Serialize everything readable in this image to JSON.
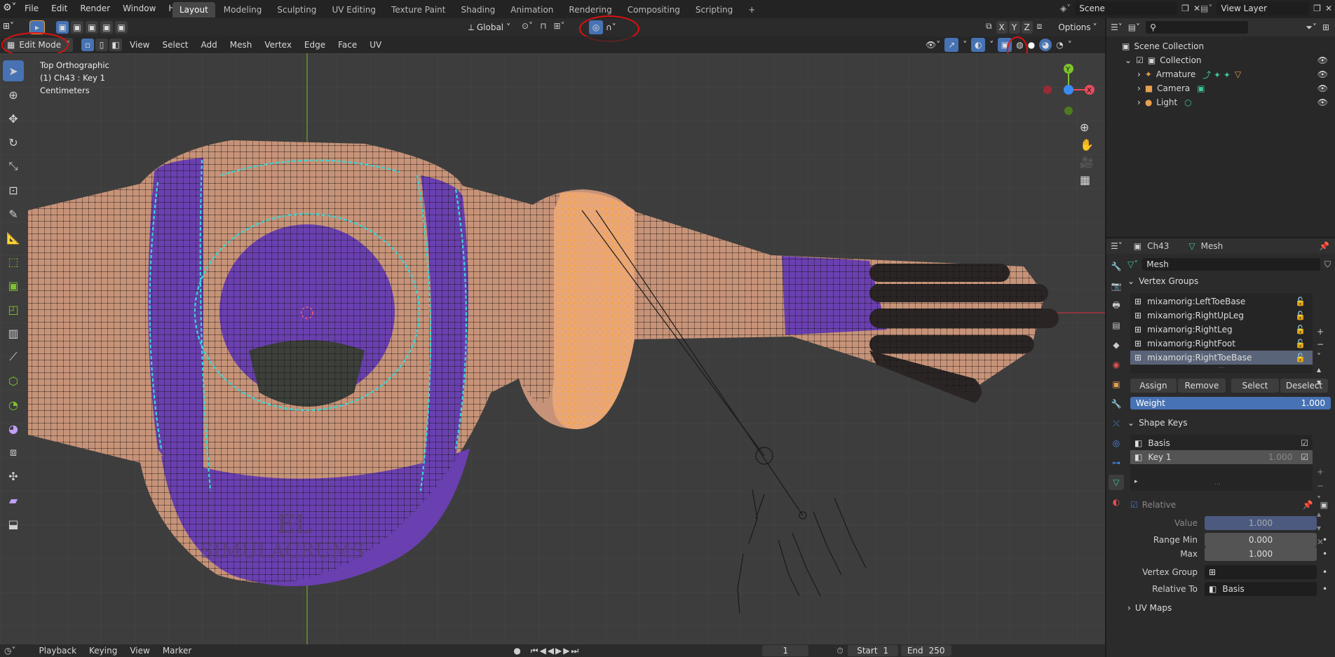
{
  "topbar": {
    "menus": [
      "File",
      "Edit",
      "Render",
      "Window",
      "Help"
    ],
    "workspaces": [
      "Layout",
      "Modeling",
      "Sculpting",
      "UV Editing",
      "Texture Paint",
      "Shading",
      "Animation",
      "Rendering",
      "Compositing",
      "Scripting"
    ],
    "active_workspace": "Layout",
    "add_tab": "+",
    "scene": "Scene",
    "view_layer": "View Layer"
  },
  "viewport_header": {
    "orientation": "Global",
    "options": "Options",
    "mode": "Edit Mode",
    "menus": [
      "View",
      "Select",
      "Add",
      "Mesh",
      "Vertex",
      "Edge",
      "Face",
      "UV"
    ],
    "xyz": [
      "X",
      "Y",
      "Z"
    ]
  },
  "overlay_text": {
    "view": "Top Orthographic",
    "object": "(1) Ch43 : Key 1",
    "units": "Centimeters",
    "watermark_line1": "EL",
    "watermark_line2": "SIMULACRUMS"
  },
  "gizmo": {
    "y": "Y",
    "x": "X"
  },
  "outliner": {
    "search_placeholder": "",
    "root": "Scene Collection",
    "collection": "Collection",
    "items": [
      "Armature",
      "Camera",
      "Light"
    ]
  },
  "properties": {
    "object": "Ch43",
    "data_label": "Mesh",
    "mesh_name": "Mesh",
    "vertex_groups_title": "Vertex Groups",
    "vertex_groups": [
      "mixamorig:LeftToeBase",
      "mixamorig:RightUpLeg",
      "mixamorig:RightLeg",
      "mixamorig:RightFoot",
      "mixamorig:RightToeBase"
    ],
    "selected_vertex_group": 4,
    "vg_buttons": [
      "Assign",
      "Remove",
      "Select",
      "Deselect"
    ],
    "weight_label": "Weight",
    "weight_value": "1.000",
    "weight_fraction": 1.0,
    "shape_keys_title": "Shape Keys",
    "shape_keys": [
      {
        "name": "Basis",
        "value": ""
      },
      {
        "name": "Key 1",
        "value": "1.000"
      }
    ],
    "relative_label": "Relative",
    "value_label": "Value",
    "value": "1.000",
    "range_min_label": "Range Min",
    "range_min": "0.000",
    "max_label": "Max",
    "max": "1.000",
    "vertex_group_label": "Vertex Group",
    "relative_to_label": "Relative To",
    "relative_to": "Basis",
    "uv_maps_title": "UV Maps"
  },
  "timeline": {
    "menus": [
      "Playback",
      "Keying",
      "View",
      "Marker"
    ],
    "frame": "1",
    "start_label": "Start",
    "start": "1",
    "end_label": "End",
    "end": "250"
  },
  "colors": {
    "accent": "#4772b3",
    "skin": "#c79378",
    "purple": "#6a3fb0",
    "selected_orange": "#ff9a2e",
    "seam_cyan": "#38d6d6",
    "annotation_red": "#e01010",
    "axis_x": "#e84b5c",
    "axis_y": "#7dc32d",
    "axis_z": "#3b8cf0"
  }
}
